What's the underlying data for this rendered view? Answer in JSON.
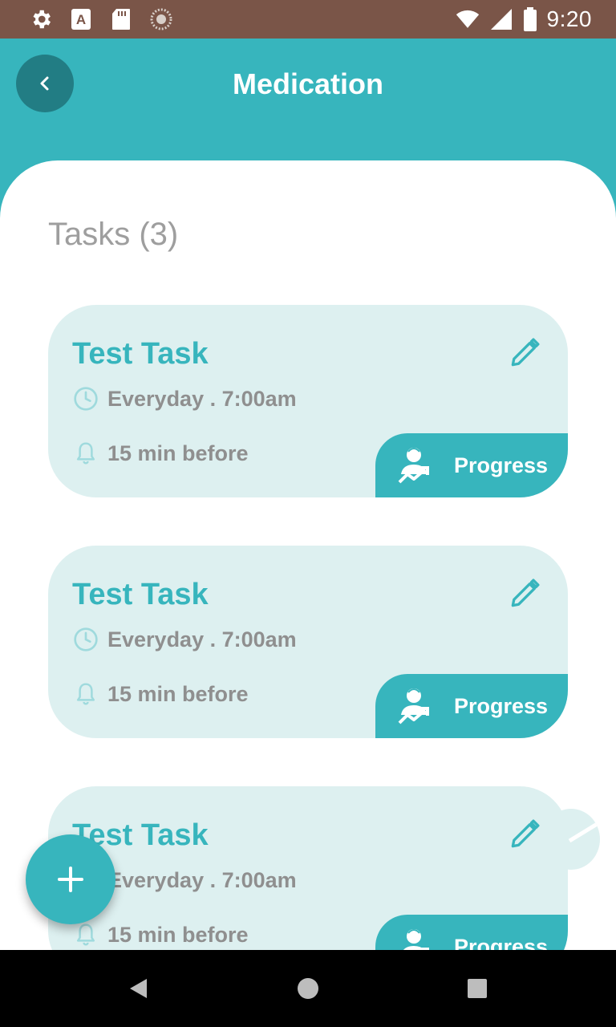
{
  "status_bar": {
    "time": "9:20",
    "left_icons": [
      "settings-icon",
      "text-a-icon",
      "sd-card-icon",
      "sync-icon"
    ],
    "right_icons": [
      "wifi-icon",
      "cell-signal-icon",
      "battery-icon"
    ]
  },
  "header": {
    "title": "Medication",
    "back_icon": "chevron-left-icon"
  },
  "tasks": {
    "heading": "Tasks (3)",
    "items": [
      {
        "title": "Test Task",
        "schedule": "Everyday . 7:00am",
        "reminder": "15 min before",
        "progress_label": "Progress"
      },
      {
        "title": "Test Task",
        "schedule": "Everyday . 7:00am",
        "reminder": "15 min before",
        "progress_label": "Progress"
      },
      {
        "title": "Test Task",
        "schedule": "Everyday . 7:00am",
        "reminder": "15 min before",
        "progress_label": "Progress"
      }
    ]
  },
  "fab": {
    "icon": "plus-icon"
  },
  "nav_bar": {
    "icons": [
      "back-triangle-icon",
      "home-circle-icon",
      "recents-square-icon"
    ]
  },
  "colors": {
    "primary": "#37b5bd",
    "primary_dark": "#227d84",
    "card_bg": "#ddf0f0",
    "status_bar": "#7a5548",
    "muted_text": "#8f8f8f"
  }
}
